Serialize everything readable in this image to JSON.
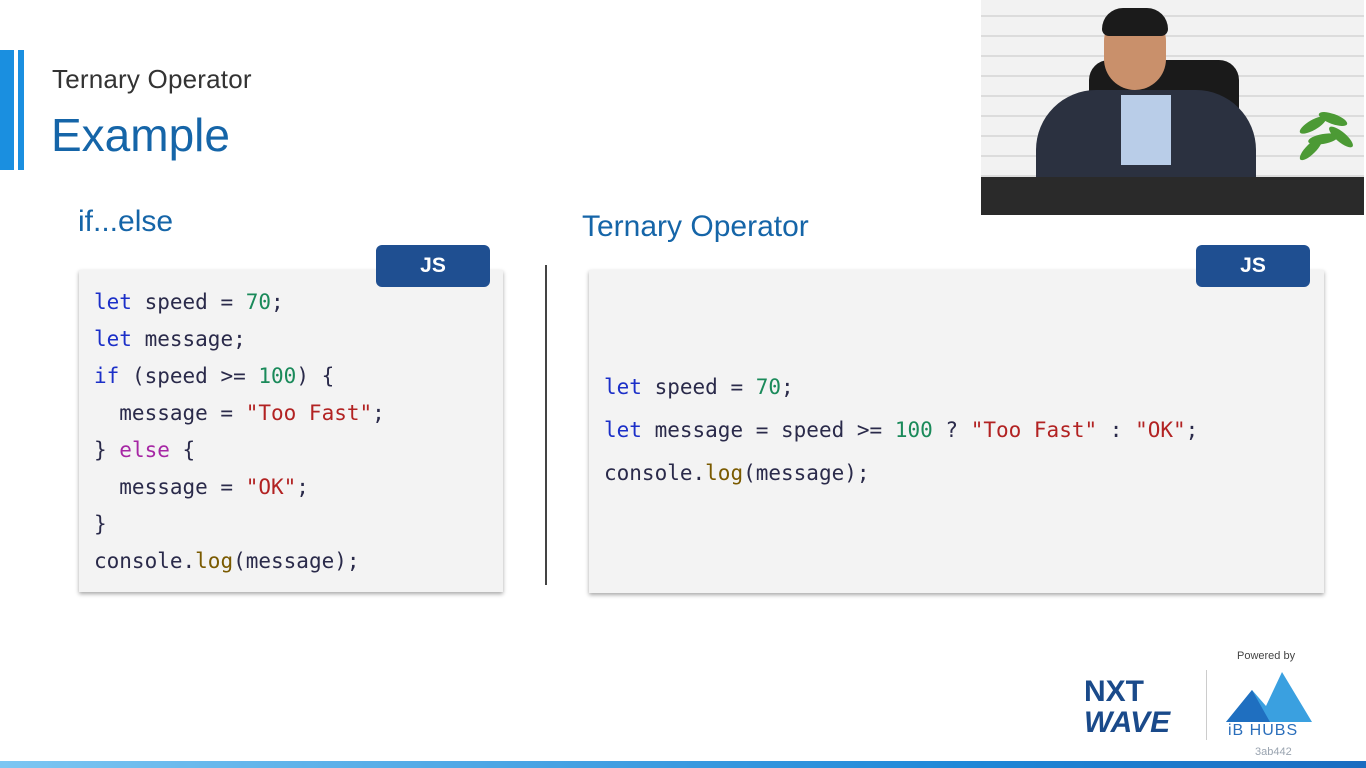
{
  "header": {
    "subtitle": "Ternary Operator",
    "title": "Example"
  },
  "left_section": {
    "heading": "if...else",
    "badge": "JS"
  },
  "right_section": {
    "heading": "Ternary Operator",
    "badge": "JS"
  },
  "branding": {
    "nxt": "NXT",
    "wave": "WAVE",
    "powered_by": "Powered by",
    "ib_hubs": "iB HUBS",
    "code_id": "3ab442"
  },
  "colors": {
    "title_blue": "#1565a8",
    "badge_blue": "#1f4f91",
    "accent_blue": "#1a8fe0"
  },
  "left_code": [
    [
      [
        "kw",
        "let"
      ],
      [
        "p",
        " speed = "
      ],
      [
        "num",
        "70"
      ],
      [
        "p",
        ";"
      ]
    ],
    [
      [
        "kw",
        "let"
      ],
      [
        "p",
        " message;"
      ]
    ],
    [
      [
        "kw",
        "if"
      ],
      [
        "p",
        " (speed >= "
      ],
      [
        "num",
        "100"
      ],
      [
        "p",
        ") {"
      ]
    ],
    [
      [
        "p",
        "  message = "
      ],
      [
        "str",
        "\"Too Fast\""
      ],
      [
        "p",
        ";"
      ]
    ],
    [
      [
        "p",
        "} "
      ],
      [
        "kw2",
        "else"
      ],
      [
        "p",
        " {"
      ]
    ],
    [
      [
        "p",
        "  message = "
      ],
      [
        "str",
        "\"OK\""
      ],
      [
        "p",
        ";"
      ]
    ],
    [
      [
        "p",
        "}"
      ]
    ],
    [
      [
        "p",
        "console."
      ],
      [
        "fn",
        "log"
      ],
      [
        "p",
        "(message);"
      ]
    ]
  ],
  "right_code": [
    [
      [
        "kw",
        "let"
      ],
      [
        "p",
        " speed = "
      ],
      [
        "num",
        "70"
      ],
      [
        "p",
        ";"
      ]
    ],
    [
      [
        "kw",
        "let"
      ],
      [
        "p",
        " message = speed >= "
      ],
      [
        "num",
        "100"
      ],
      [
        "p",
        " ? "
      ],
      [
        "str",
        "\"Too Fast\""
      ],
      [
        "p",
        " : "
      ],
      [
        "str",
        "\"OK\""
      ],
      [
        "p",
        ";"
      ]
    ],
    [
      [
        "p",
        "console."
      ],
      [
        "fn",
        "log"
      ],
      [
        "p",
        "(message);"
      ]
    ]
  ]
}
